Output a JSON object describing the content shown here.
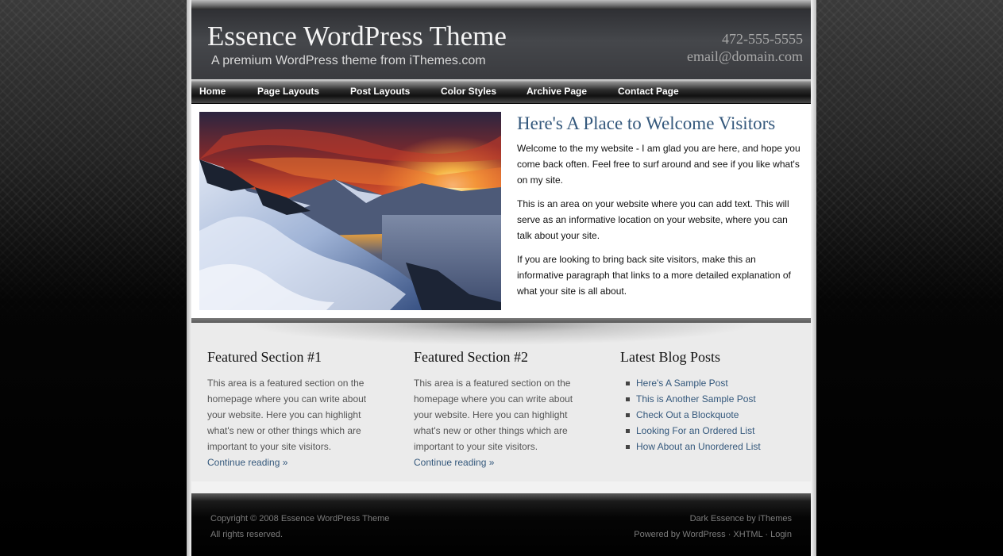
{
  "header": {
    "title": "Essence WordPress Theme",
    "tagline": "A premium WordPress theme from iThemes.com",
    "phone": "472-555-5555",
    "email": "email@domain.com"
  },
  "nav": {
    "items": [
      {
        "label": "Home"
      },
      {
        "label": "Page Layouts"
      },
      {
        "label": "Post Layouts"
      },
      {
        "label": "Color Styles"
      },
      {
        "label": "Archive Page"
      },
      {
        "label": "Contact Page"
      }
    ]
  },
  "welcome": {
    "title": "Here's A Place to Welcome Visitors",
    "paragraphs": [
      "Welcome to the my website - I am glad you are here, and hope you come back often. Feel free to surf around and see if you like what's on my site.",
      "This is an area on your website where you can add text. This will serve as an informative location on your website, where you can talk about your site.",
      "If you are looking to bring back site visitors, make this an informative paragraph that links to a more detailed explanation of what your site is all about."
    ]
  },
  "featured": [
    {
      "title": "Featured Section #1",
      "text": "This area is a featured section on the homepage where you can write about your website. Here you can highlight what's new or other things which are important to your site visitors.",
      "link": "Continue reading »"
    },
    {
      "title": "Featured Section #2",
      "text": "This area is a featured section on the homepage where you can write about your website. Here you can highlight what's new or other things which are important to your site visitors.",
      "link": "Continue reading »"
    }
  ],
  "latest": {
    "title": "Latest Blog Posts",
    "posts": [
      "Here's A Sample Post",
      "This is Another Sample Post",
      "Check Out a Blockquote",
      "Looking For an Ordered List",
      "How About an Unordered List"
    ]
  },
  "footer": {
    "copyright": "Copyright © 2008 Essence WordPress Theme",
    "rights": "All rights reserved.",
    "credit_prefix": "Dark Essence by ",
    "credit_link": "iThemes",
    "powered_by": "Powered by WordPress",
    "sep": " · ",
    "xhtml": "XHTML",
    "login": "Login"
  },
  "colors": {
    "accent_link": "#34587c",
    "header_bg": "#3a3b3f",
    "page_bg": "#000000"
  }
}
